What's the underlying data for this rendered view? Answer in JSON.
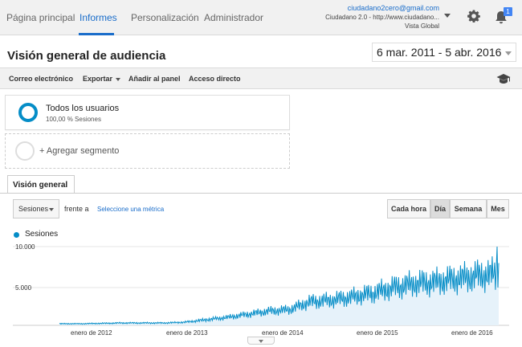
{
  "nav": {
    "tabs": [
      "Página principal",
      "Informes",
      "Personalización",
      "Administrador"
    ],
    "account_email": "ciudadano2cero@gmail.com",
    "account_property": "Ciudadano 2.0 - http://www.ciudadano...",
    "account_view": "Vista Global",
    "notifications_badge": "1",
    "icons": [
      "caret-down-icon",
      "gear-icon",
      "bell-icon"
    ]
  },
  "header": {
    "title": "Visión general de audiencia",
    "date_range": "6 mar. 2011 - 5 abr. 2016"
  },
  "toolbar": {
    "email": "Correo electrónico",
    "export": "Exportar",
    "add_dashboard": "Añadir al panel",
    "shortcut": "Acceso directo",
    "icon": "graduation-cap-icon"
  },
  "segments": {
    "active_name": "Todos los usuarios",
    "active_pct": "100,00 % Sesiones",
    "add_label": "+ Agregar segmento"
  },
  "overview_tab": "Visión general",
  "controls": {
    "metric": "Sesiones",
    "vs": "frente a",
    "choose_metric": "Seleccione una métrica",
    "periods": [
      "Cada hora",
      "Día",
      "Semana",
      "Mes"
    ],
    "active_period": "Día"
  },
  "colors": {
    "accent": "#058dc7",
    "link": "#1a6dca",
    "area_fill": "#e6f2fa"
  },
  "chart_data": {
    "type": "line",
    "series": [
      {
        "name": "Sesiones"
      }
    ],
    "y_ticks": [
      "10.000",
      "5.000"
    ],
    "ylim": [
      0,
      10000
    ],
    "x_ticks": [
      "enero de 2012",
      "enero de 2013",
      "enero de 2014",
      "enero de 2015",
      "enero de 2016"
    ],
    "x": [
      "2011-03",
      "2011-06",
      "2011-09",
      "2011-12",
      "2012-03",
      "2012-06",
      "2012-09",
      "2012-12",
      "2013-03",
      "2013-06",
      "2013-09",
      "2013-12",
      "2014-03",
      "2014-06",
      "2014-09",
      "2014-12",
      "2015-03",
      "2015-06",
      "2015-09",
      "2015-12",
      "2016-02",
      "2016-04"
    ],
    "values": [
      200,
      200,
      250,
      300,
      300,
      300,
      400,
      700,
      1000,
      1400,
      1800,
      2000,
      3000,
      3200,
      3600,
      4100,
      4800,
      5300,
      5500,
      5900,
      6300,
      6600
    ],
    "peak": 10000,
    "grid": true
  }
}
